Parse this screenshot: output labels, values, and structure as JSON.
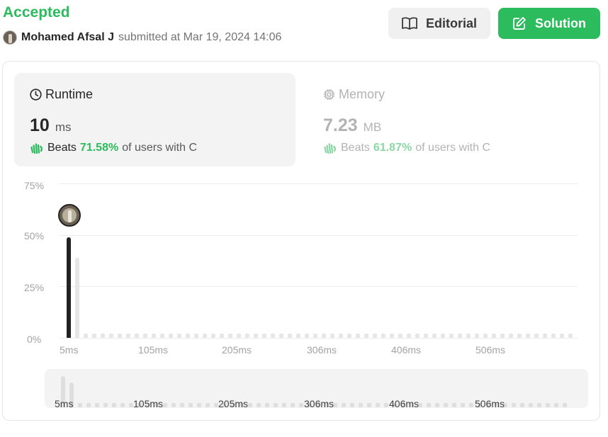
{
  "header": {
    "status": "Accepted",
    "username": "Mohamed Afsal J",
    "submitted_text": "submitted at Mar 19, 2024 14:06",
    "editorial_label": "Editorial",
    "solution_label": "Solution"
  },
  "runtime": {
    "title": "Runtime",
    "value": "10",
    "unit": "ms",
    "beats_label": "Beats",
    "beats_pct": "71.58%",
    "beats_rest": "of users with C"
  },
  "memory": {
    "title": "Memory",
    "value": "7.23",
    "unit": "MB",
    "beats_label": "Beats",
    "beats_pct": "61.87%",
    "beats_rest": "of users with C"
  },
  "colors": {
    "accent_green": "#2cbb5d",
    "bar_user": "#222222",
    "bar_other": "#e6e6e6"
  },
  "icons": {
    "editorial": "book-open-icon",
    "solution": "edit-note-icon",
    "runtime": "clock-icon",
    "memory": "chip-icon",
    "beats": "waving-hand-icon"
  },
  "chart_data": {
    "type": "bar",
    "y_tick_labels": [
      "75%",
      "50%",
      "25%",
      "0%"
    ],
    "x_tick_labels": [
      "5ms",
      "105ms",
      "205ms",
      "306ms",
      "406ms",
      "506ms"
    ],
    "ylim": [
      0,
      75
    ],
    "grid": true,
    "series": [
      {
        "categories": [
          "5ms",
          "10ms"
        ],
        "values": [
          49,
          39
        ]
      }
    ],
    "highlighted_category": "5ms",
    "user_value": "10 ms"
  },
  "mini_chart": {
    "x_tick_labels": [
      "5ms",
      "105ms",
      "205ms",
      "306ms",
      "406ms",
      "506ms"
    ]
  }
}
